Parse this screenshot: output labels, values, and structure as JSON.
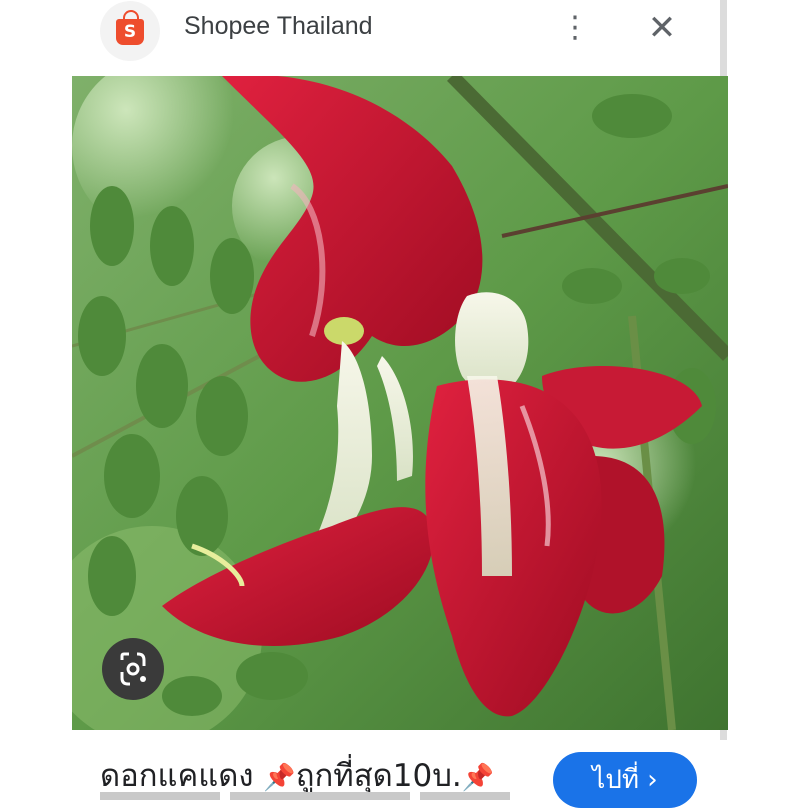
{
  "header": {
    "site_name": "Shopee Thailand",
    "logo_letter": "S",
    "more_icon": "more-vert-icon",
    "close_icon": "close-icon"
  },
  "image": {
    "lens_icon": "google-lens-icon"
  },
  "footer": {
    "caption_part1": "ดอกแคแดง",
    "caption_part2": "ถูกที่สุด10บ.",
    "pin_glyph": "📌",
    "visit_label": "ไปที่",
    "visit_chevron": "›"
  },
  "colors": {
    "brand": "#ee4d2d",
    "button": "#1a73e8",
    "flower": "#c8102e",
    "foliage": "#4f8a3a"
  }
}
